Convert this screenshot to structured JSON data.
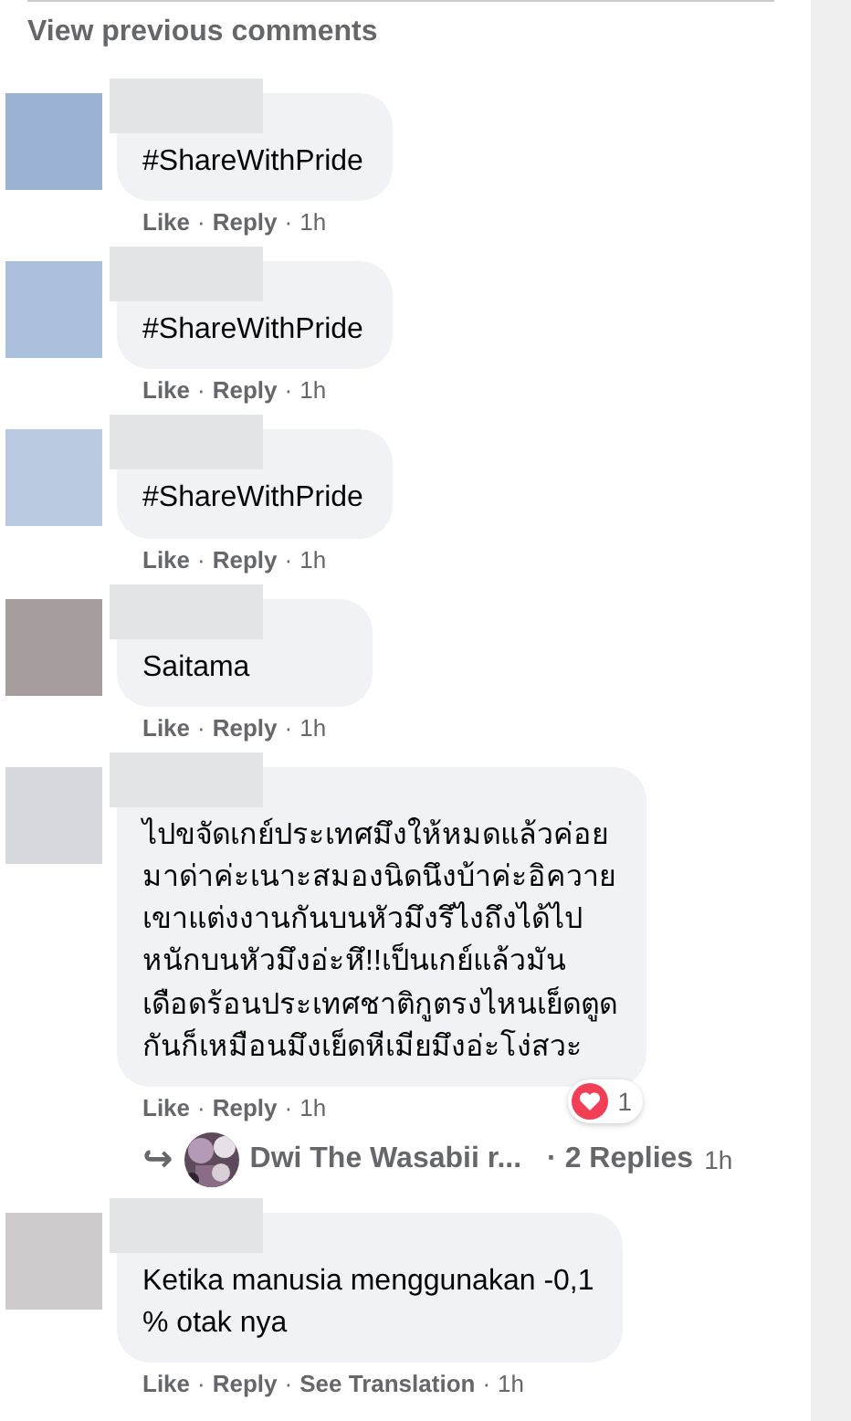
{
  "view_previous": "View previous comments",
  "action_separator": "·",
  "comments": [
    {
      "color": "#9bb2d3",
      "name_hidden": true,
      "text": "#ShareWithPride",
      "actions": [
        {
          "kind": "link",
          "label": "Like"
        },
        {
          "kind": "link",
          "label": "Reply"
        },
        {
          "kind": "time",
          "label": "1h"
        }
      ]
    },
    {
      "color": "#a9bfdc",
      "name_hidden": true,
      "text": "#ShareWithPride",
      "actions": [
        {
          "kind": "link",
          "label": "Like"
        },
        {
          "kind": "link",
          "label": "Reply"
        },
        {
          "kind": "time",
          "label": "1h"
        }
      ]
    },
    {
      "color": "#b9c9e0",
      "name_hidden": true,
      "text": "#ShareWithPride",
      "actions": [
        {
          "kind": "link",
          "label": "Like"
        },
        {
          "kind": "link",
          "label": "Reply"
        },
        {
          "kind": "time",
          "label": "1h"
        }
      ]
    },
    {
      "color": "#a59d9b",
      "name_hidden": true,
      "text": "Saitama",
      "actions": [
        {
          "kind": "link",
          "label": "Like"
        },
        {
          "kind": "link",
          "label": "Reply"
        },
        {
          "kind": "time",
          "label": "1h"
        }
      ]
    },
    {
      "color": "#d5d9dd",
      "name_hidden": true,
      "text": "ไปขจัดเกย์ประเทศมึงให้หมดแล้วค่อย\nมาด่าค่ะเนาะสมองนิดนึงบ้าค่ะอิควาย\nเขาแต่งงานกันบนหัวมึงรึไงถึงได้ไป\nหนักบนหัวมึงอ่ะหึ!!เป็นเกย์แล้วมัน\nเดือดร้อนประเทศชาติกูตรงไหนเย็ดตูด\nกันก็เหมือนมึงเย็ดหีเมียมึงอ่ะโง่สวะ",
      "reaction": {
        "count": "1"
      },
      "actions": [
        {
          "kind": "link",
          "label": "Like"
        },
        {
          "kind": "link",
          "label": "Reply"
        },
        {
          "kind": "time",
          "label": "1h"
        }
      ],
      "replies": {
        "arrow": "↪",
        "name": "Dwi The Wasabii r...",
        "count": "· 2 Replies",
        "time": "1h"
      }
    },
    {
      "color": "#cfcbcc",
      "name_hidden": true,
      "text": "Ketika manusia menggunakan -0,1\n% otak nya",
      "actions": [
        {
          "kind": "link",
          "label": "Like"
        },
        {
          "kind": "link",
          "label": "Reply"
        },
        {
          "kind": "link",
          "label": "See Translation"
        },
        {
          "kind": "time",
          "label": "1h"
        }
      ]
    }
  ]
}
